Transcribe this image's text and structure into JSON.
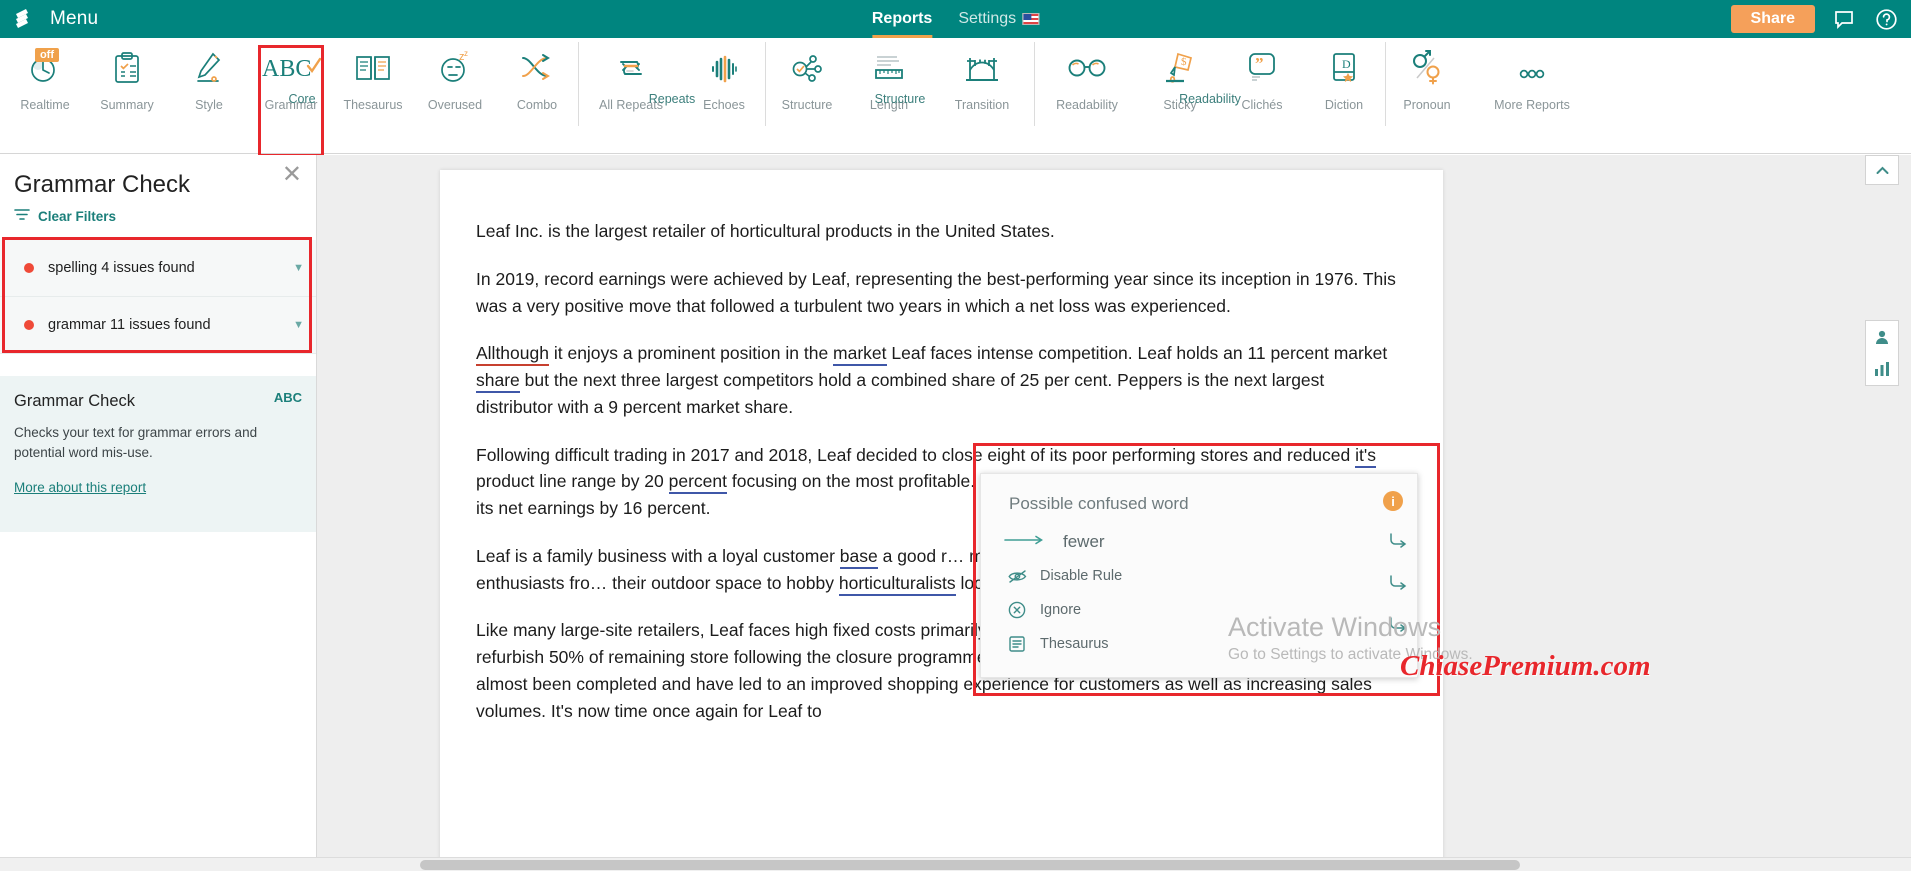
{
  "topbar": {
    "menu_label": "Menu",
    "logo_icon": "prowritingaid-book-logo",
    "nav": [
      {
        "label": "Reports",
        "active": true,
        "icon": null
      },
      {
        "label": "Settings",
        "active": false,
        "icon": "us-flag-icon"
      }
    ],
    "share_label": "Share",
    "comment_icon": "comment-icon",
    "help_icon": "help-circle-icon"
  },
  "ribbon": {
    "groups": [
      {
        "group_label": "",
        "items": [
          {
            "label": "Realtime",
            "icon": "stopwatch-icon",
            "badge": "off"
          },
          {
            "label": "Summary",
            "icon": "clipboard-icon"
          },
          {
            "label": "Style",
            "icon": "pencil-icon"
          }
        ]
      },
      {
        "group_label": "Core",
        "items": [
          {
            "label": "Grammar",
            "icon": "abc-check-icon",
            "selected": true
          },
          {
            "label": "Thesaurus",
            "icon": "open-book-icon"
          },
          {
            "label": "Overused",
            "icon": "sleepy-face-icon"
          },
          {
            "label": "Combo",
            "icon": "shuffle-arrows-icon"
          }
        ]
      },
      {
        "group_label": "Repeats",
        "items": [
          {
            "label": "All Repeats",
            "icon": "repeat-arrows-icon"
          },
          {
            "label": "Echoes",
            "icon": "soundwave-icon"
          }
        ]
      },
      {
        "group_label": "Structure",
        "items": [
          {
            "label": "Structure",
            "icon": "node-graph-icon"
          },
          {
            "label": "Length",
            "icon": "ruler-icon"
          },
          {
            "label": "Transition",
            "icon": "bridge-icon"
          }
        ]
      },
      {
        "group_label": "Readability",
        "items": [
          {
            "label": "Readability",
            "icon": "glasses-icon"
          },
          {
            "label": "Sticky",
            "icon": "glue-bottle-icon"
          },
          {
            "label": "Clichés",
            "icon": "quote-bubble-icon"
          },
          {
            "label": "Diction",
            "icon": "dictionary-book-icon"
          }
        ]
      },
      {
        "group_label": "",
        "items": [
          {
            "label": "Pronoun",
            "icon": "gender-symbols-icon"
          },
          {
            "label": "More Reports",
            "icon": "ellipsis-icon"
          }
        ]
      }
    ]
  },
  "sidepanel": {
    "title": "Grammar Check",
    "close_icon": "close-icon",
    "filter_icon": "filter-icon",
    "clear_filters": "Clear Filters",
    "filters": [
      {
        "label": "spelling 4 issues found",
        "dot_color": "#ef4a38",
        "chevron": "chevron-down-icon"
      },
      {
        "label": "grammar 11 issues found",
        "dot_color": "#ef4a38",
        "chevron": "chevron-down-icon"
      }
    ],
    "info": {
      "title": "Grammar Check",
      "badge": "ABC",
      "body": "Checks your text for grammar errors and potential word mis-use.",
      "link": "More about this report"
    }
  },
  "document": {
    "paragraphs": [
      {
        "id": "p1",
        "text": "Leaf Inc. is the largest retailer of horticultural products in the United States."
      },
      {
        "id": "p2",
        "text": "In 2019, record earnings were achieved by Leaf, representing the best-performing year since its inception in 1976. This was a very positive move that followed a turbulent two years in which a net loss was experienced."
      },
      {
        "id": "p3",
        "text": "Allthough it enjoys a prominent position in the market Leaf faces intense competition. Leaf holds an 11 percent market share but the next three largest competitors hold a combined share of 25 per cent. Peppers is the next largest distributor with a 9 percent market share."
      },
      {
        "id": "p4",
        "text": "Following difficult trading in 2017 and 2018, Leaf decided to close eight of its poor performing stores and reduced it's product line range by 20 percent focusing on the most profitable. Having less stores has contributed to Leaf improving its net earnings by 16 percent."
      },
      {
        "id": "p5",
        "text": "Leaf is a family business with a loyal customer base a good reputation and a strong brand. The company manages to target a wide range of gardening enthusiasts from professional landscapers keen to improve their outdoor space to hobby horticulturalists looking for products."
      },
      {
        "id": "p6",
        "text": "Like many large-site retailers, Leaf faces high fixed costs primarily in rents and staffing. In 2017, a decision was made to refurbish 50% of remaining store following the closure programme by the end of 2018. The renovations have now almost been completed and have led to an improved shopping experience for customers as well as increasing sales volumes. It's now time once again for Leaf to"
      }
    ]
  },
  "popup": {
    "title": "Possible confused word",
    "info_icon": "info-icon",
    "info_badge": "i",
    "suggestion": "fewer",
    "suggestion_arrow_icon": "arrow-right-icon",
    "actions": [
      {
        "label": "Disable Rule",
        "icon": "eye-off-icon"
      },
      {
        "label": "Ignore",
        "icon": "circle-x-icon"
      },
      {
        "label": "Thesaurus",
        "icon": "list-lines-icon"
      }
    ],
    "side_buttons": [
      {
        "icon": "arrow-curve-right-icon"
      },
      {
        "icon": "arrow-curve-right-icon"
      },
      {
        "icon": "arrow-curve-right-icon"
      }
    ]
  },
  "right_rail": {
    "collapse_icon": "chevron-up-icon",
    "buttons": [
      {
        "icon": "user-icon"
      },
      {
        "icon": "bar-chart-icon"
      }
    ]
  },
  "watermarks": {
    "activate_title": "Activate Windows",
    "activate_sub": "Go to Settings to activate Windows.",
    "site": "ChiasePremium.com"
  },
  "colors": {
    "brand_teal": "#00857f",
    "accent_orange": "#f5a05a",
    "highlight_red": "#e8272c",
    "issue_dot": "#ef4a38",
    "spelling_underline": "#c7402f",
    "grammar_underline": "#3f57a8"
  }
}
